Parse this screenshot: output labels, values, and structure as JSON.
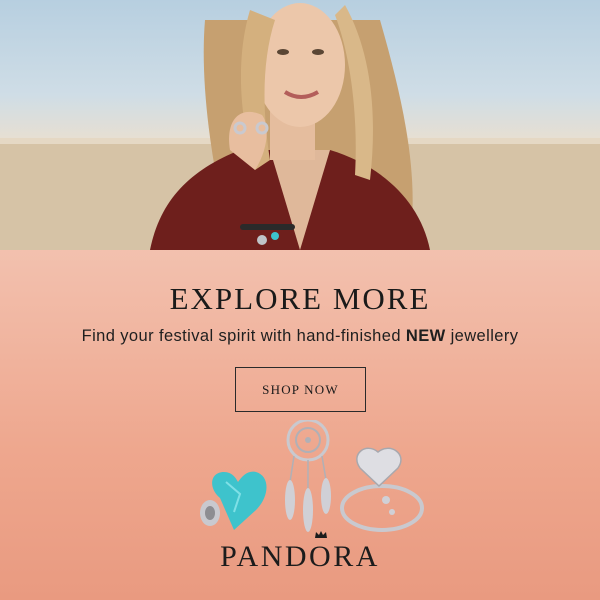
{
  "banner": {
    "headline": "EXPLORE MORE",
    "subline_before": "Find your festival spirit with hand-finished ",
    "subline_emphasis": "NEW",
    "subline_after": " jewellery",
    "cta_label": "SHOP NOW",
    "brand_pre": "PAND",
    "brand_crown_letter": "O",
    "brand_post": "RA"
  },
  "colors": {
    "background_top": "#f6d9cc",
    "background_bottom": "#e99a80",
    "text": "#1a1a1a",
    "turquoise": "#3ec3cc",
    "silver": "#c9c9cf"
  },
  "icons": {
    "brand_crown": "crown-icon",
    "charm_1": "turquoise-heart-charm",
    "charm_2": "dreamcatcher-pendant",
    "charm_3": "heart-ring"
  }
}
